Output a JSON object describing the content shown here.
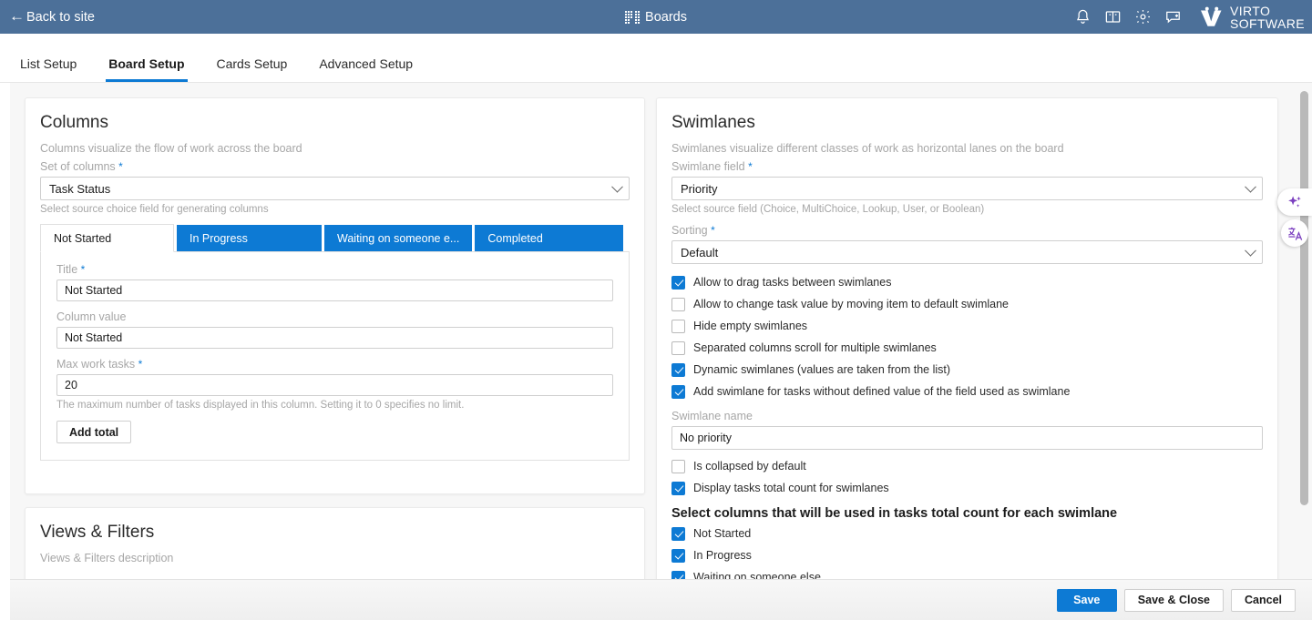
{
  "topbar": {
    "back_label": "Back to site",
    "center_title": "Boards",
    "icons": [
      "bell-icon",
      "book-icon",
      "gear-icon",
      "chat-add-icon"
    ],
    "logo_line1": "VIRTO",
    "logo_line2": "SOFTWARE",
    "bg_color": "#4c7099"
  },
  "tabs": [
    {
      "label": "List Setup",
      "active": false
    },
    {
      "label": "Board Setup",
      "active": true
    },
    {
      "label": "Cards Setup",
      "active": false
    },
    {
      "label": "Advanced Setup",
      "active": false
    }
  ],
  "accent_color": "#0d7ad4",
  "columns_panel": {
    "title": "Columns",
    "description": "Columns visualize the flow of work across the board",
    "set_of_columns_label": "Set of columns",
    "set_of_columns_value": "Task Status",
    "set_of_columns_help": "Select source choice field for generating columns",
    "column_tabs": [
      {
        "label": "Not Started",
        "active": true
      },
      {
        "label": "In Progress",
        "active": false
      },
      {
        "label": "Waiting on someone e...",
        "active": false
      },
      {
        "label": "Completed",
        "active": false
      }
    ],
    "title_label": "Title",
    "title_value": "Not Started",
    "column_value_label": "Column value",
    "column_value_value": "Not Started",
    "max_work_tasks_label": "Max work tasks",
    "max_work_tasks_value": "20",
    "max_work_tasks_help": "The maximum number of tasks displayed in this column. Setting it to 0 specifies no limit.",
    "add_total_label": "Add total"
  },
  "views_panel": {
    "title": "Views & Filters",
    "description": "Views & Filters description"
  },
  "swimlanes_panel": {
    "title": "Swimlanes",
    "description": "Swimlanes visualize different classes of work as horizontal lanes on the board",
    "field_label": "Swimlane field",
    "field_value": "Priority",
    "field_help": "Select source field (Choice, MultiChoice, Lookup, User, or Boolean)",
    "sorting_label": "Sorting",
    "sorting_value": "Default",
    "options": [
      {
        "label": "Allow to drag tasks between swimlanes",
        "checked": true
      },
      {
        "label": "Allow to change task value by moving item to default swimlane",
        "checked": false
      },
      {
        "label": "Hide empty swimlanes",
        "checked": false
      },
      {
        "label": "Separated columns scroll for multiple swimlanes",
        "checked": false
      },
      {
        "label": "Dynamic swimlanes (values are taken from the list)",
        "checked": true
      },
      {
        "label": "Add swimlane for tasks without defined value of the field used as swimlane",
        "checked": true
      }
    ],
    "swimlane_name_label": "Swimlane name",
    "swimlane_name_value": "No priority",
    "options2": [
      {
        "label": "Is collapsed by default",
        "checked": false
      },
      {
        "label": "Display tasks total count for swimlanes",
        "checked": true
      }
    ],
    "total_count_heading": "Select columns that will be used in tasks total count for each swimlane",
    "total_count_columns": [
      {
        "label": "Not Started",
        "checked": true
      },
      {
        "label": "In Progress",
        "checked": true
      },
      {
        "label": "Waiting on someone else",
        "checked": true
      }
    ]
  },
  "side_buttons": [
    {
      "name": "ai-sparkle-icon"
    },
    {
      "name": "translate-icon"
    }
  ],
  "footer": {
    "save_label": "Save",
    "save_close_label": "Save & Close",
    "cancel_label": "Cancel"
  }
}
